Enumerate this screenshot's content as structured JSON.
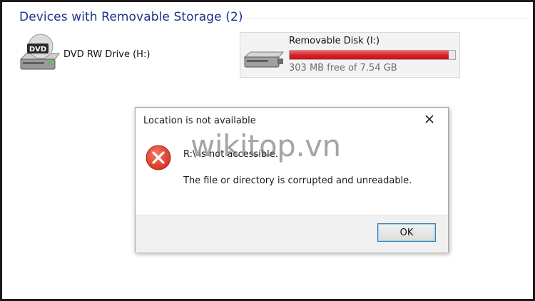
{
  "group": {
    "title": "Devices with Removable Storage (2)"
  },
  "devices": [
    {
      "name": "DVD RW Drive (H:)",
      "icon": "dvd-drive-icon",
      "badge": "DVD"
    },
    {
      "name": "Removable Disk (I:)",
      "icon": "usb-drive-icon",
      "free_text": "303 MB free of 7.54 GB",
      "used_fraction": 0.96
    }
  ],
  "dialog": {
    "title": "Location is not available",
    "close_icon": "close-icon",
    "error_icon": "error-icon",
    "message_line1": "R:\\ is not accessible.",
    "message_line2": "The file or directory is corrupted and unreadable.",
    "ok_label": "OK"
  },
  "watermark": "wikitop.vn",
  "colors": {
    "header_text": "#1e3287",
    "capacity_fill": "#d81e28",
    "error_red": "#e04433",
    "ok_border": "#3c7fb1"
  }
}
